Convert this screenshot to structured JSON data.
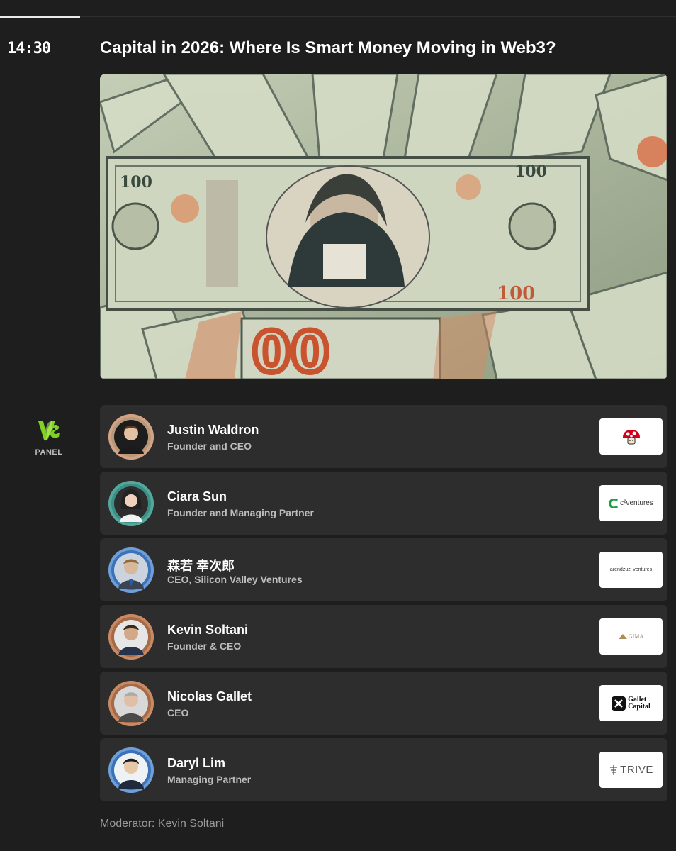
{
  "session": {
    "time": "14:30",
    "title": "Capital in 2026: Where Is Smart Money Moving in Web3?",
    "type_label": "PANEL",
    "type_icon": "vs-icon",
    "progress_fraction": 0.12
  },
  "hero_image": {
    "icon": "money-banknotes-image"
  },
  "speakers": [
    {
      "name": "Justin Waldron",
      "role": "Founder and CEO",
      "logo_icon": "mushroom-logo-icon",
      "logo_text": ""
    },
    {
      "name": "Ciara Sun",
      "role": "Founder and Managing Partner",
      "logo_icon": "c2-ventures-logo-icon",
      "logo_text": "c²ventures"
    },
    {
      "name": "森若 幸次郎",
      "role": "CEO, Silicon Valley Ventures",
      "logo_icon": "ventures-logo-icon",
      "logo_text": "arendzuzi ventures"
    },
    {
      "name": "Kevin Soltani",
      "role": "Founder & CEO",
      "logo_icon": "gima-logo-icon",
      "logo_text": "GIMA"
    },
    {
      "name": "Nicolas Gallet",
      "role": "CEO",
      "logo_icon": "gallet-capital-logo-icon",
      "logo_text": "Gallet Capital",
      "logo_line1": "Gallet",
      "logo_line2": "Capital"
    },
    {
      "name": "Daryl Lim",
      "role": "Managing Partner",
      "logo_icon": "trive-logo-icon",
      "logo_text": "TRIVE"
    }
  ],
  "moderator": {
    "label": "Moderator:",
    "name": "Kevin Soltani"
  },
  "colors": {
    "background": "#1e1e1e",
    "card": "#2d2d2d",
    "accent_green": "#7ed321",
    "muted_text": "#bdbdbd"
  }
}
